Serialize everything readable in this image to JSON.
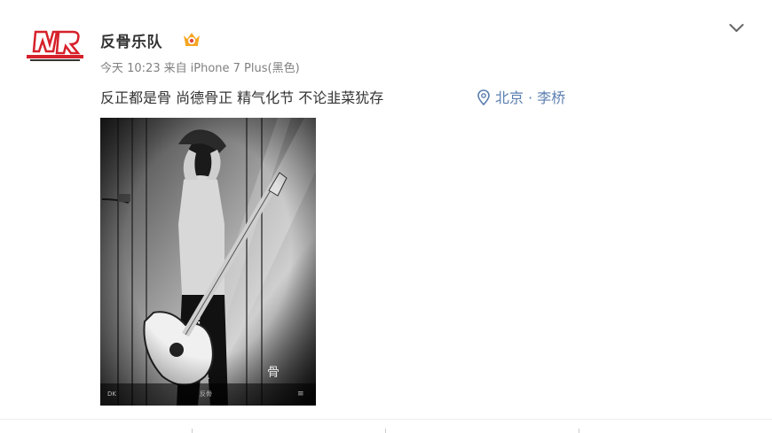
{
  "post": {
    "username": "反骨乐队",
    "meta": {
      "time": "今天 10:23",
      "source_prefix": "来自",
      "device": "iPhone 7 Plus(黑色)"
    },
    "content": "反正都是骨 尚德骨正 精气化节 不论韭菜犹存",
    "location": "北京 · 李桥",
    "photo": {
      "watermark": "骨",
      "corner_left": "DK",
      "corner_center": "反骨",
      "corner_right": "≡"
    }
  },
  "colors": {
    "link": "#5b7fb0",
    "vip_badge": "#f5a623",
    "meta_text": "#808080",
    "logo_red": "#d6202a"
  },
  "icons": {
    "avatar": "band-logo",
    "vip": "vip-crown-icon",
    "chevron": "chevron-down-icon",
    "location": "location-pin-icon"
  }
}
